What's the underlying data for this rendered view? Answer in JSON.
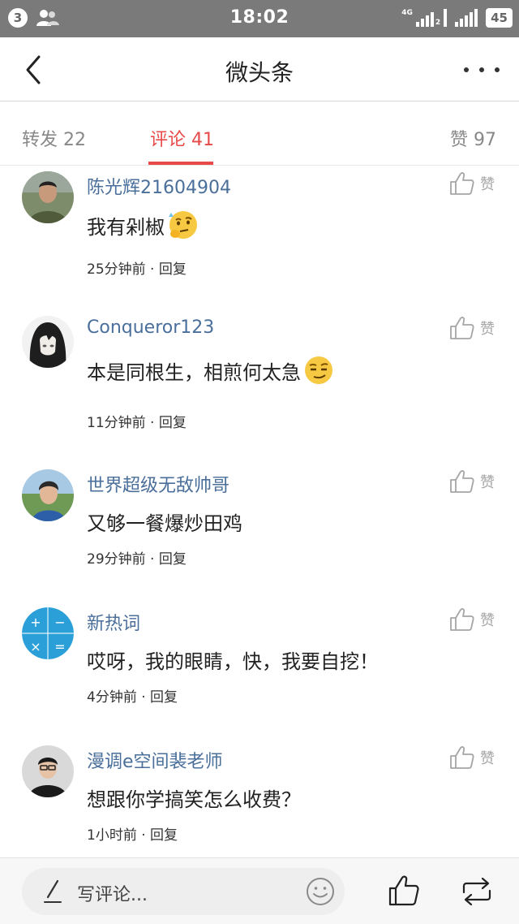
{
  "status_bar": {
    "notification_count": "3",
    "time": "18:02",
    "network_label": "4G",
    "sim_slot": "2",
    "battery": "45"
  },
  "nav": {
    "title": "微头条"
  },
  "tabs": {
    "repost": "转发 22",
    "comments": "评论 41",
    "likes": "赞 97",
    "active": "comments",
    "active_color": "#e84a4a"
  },
  "comments": [
    {
      "user": "陈光辉21604904",
      "text": "我有剁椒",
      "emoji": "thinking-face-emoji",
      "time": "25分钟前",
      "reply": "回复",
      "like_label": "赞"
    },
    {
      "user": "Conqueror123",
      "text": "本是同根生，相煎何太急",
      "emoji": "smirk-face-emoji",
      "time": "11分钟前",
      "reply": "回复",
      "like_label": "赞"
    },
    {
      "user": "世界超级无敌帅哥",
      "text": "又够一餐爆炒田鸡",
      "time": "29分钟前",
      "reply": "回复",
      "like_label": "赞"
    },
    {
      "user": "新热词",
      "text": "哎呀，我的眼睛，快，我要自挖！",
      "time": "4分钟前",
      "reply": "回复",
      "like_label": "赞",
      "avatar_symbols": [
        "+",
        "−",
        "×",
        "="
      ]
    },
    {
      "user": "漫调e空间裴老师",
      "text": "想跟你学搞笑怎么收费？",
      "time": "1小时前",
      "reply": "回复",
      "like_label": "赞"
    }
  ],
  "meta_separator": " · ",
  "bottom_bar": {
    "input_placeholder": "写评论..."
  },
  "colors": {
    "username": "#4a6f9a",
    "accent": "#e84a4a",
    "status_bar": "#7a7a7a"
  }
}
